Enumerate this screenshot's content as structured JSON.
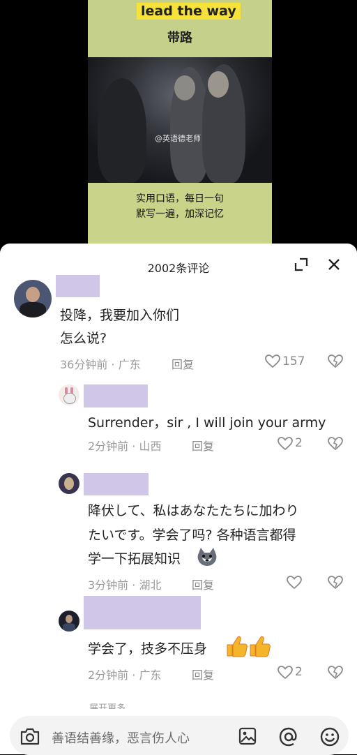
{
  "video": {
    "title_en": "lead the way",
    "title_cn": "带路",
    "watermark": "@英语德老师",
    "caption_line1": "实用口语，每日一句",
    "caption_line2": "默写一遍，加深记忆"
  },
  "panel": {
    "count_label": "2002条评论"
  },
  "comments": [
    {
      "body_line1": "投降，我要加入你们",
      "body_line2": "怎么说?",
      "time_place": "36分钟前 · 广东",
      "reply": "回复",
      "likes": "157"
    },
    {
      "body_line1": "Surrender，sir , I will join your army",
      "time_place": "2分钟前 · 山西",
      "reply": "回复",
      "likes": "2"
    },
    {
      "body_line1": "降伏して、私はあなたたちに加わり",
      "body_line2": "たいです。学会了吗? 各种语言都得",
      "body_line3": "学一下拓展知识",
      "time_place": "3分钟前 · 湖北",
      "reply": "回复",
      "likes": ""
    },
    {
      "body_line1": "学会了，技多不压身",
      "time_place": "2分钟前 · 广东",
      "reply": "回复",
      "likes": "2"
    }
  ],
  "expand_more": "展开更多",
  "input": {
    "placeholder": "善语结善缘，恶言伤人心"
  },
  "icons": {
    "expand": "expand-icon",
    "close": "close-icon",
    "like": "heart-icon",
    "dislike": "broken-heart-icon",
    "camera": "camera-icon",
    "image": "image-icon",
    "mention": "at-icon",
    "emoji": "emoji-icon"
  }
}
